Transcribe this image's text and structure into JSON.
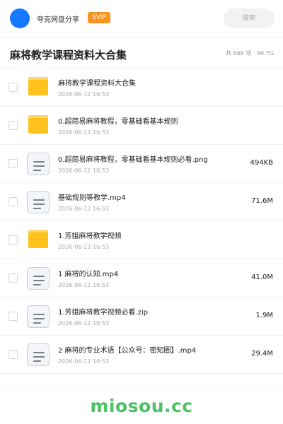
{
  "header": {
    "share_name": "夸克网盘分享",
    "badge": "SVIP",
    "search_placeholder": "搜索",
    "accent_color": "#1677ff",
    "badge_color": "#f7931e"
  },
  "folder": {
    "title": "麻将教学课程资料大合集",
    "summary": "共 666 项 · 96.7G"
  },
  "files": [
    {
      "type": "folder",
      "name": "麻将教学课程资料大合集",
      "date": "2026-06-12 16:53",
      "size": ""
    },
    {
      "type": "folder",
      "name": "0.超简易麻将教程，零基础看基本规则",
      "date": "2026-06-12 16:53",
      "size": ""
    },
    {
      "type": "file",
      "name": "0.超简易麻将教程，零基础看基本规则必看.png",
      "date": "2026-06-12 16:53",
      "size": "494KB"
    },
    {
      "type": "file",
      "name": "基础规则等教学.mp4",
      "date": "2026-06-12 16:53",
      "size": "71.6M"
    },
    {
      "type": "folder",
      "name": "1.芳姐麻将教学视频",
      "date": "2026-06-12 16:53",
      "size": ""
    },
    {
      "type": "file",
      "name": "1 麻将的认知.mp4",
      "date": "2026-06-12 16:53",
      "size": "41.0M"
    },
    {
      "type": "file",
      "name": "1.芳姐麻将教学视频必看.zip",
      "date": "2026-06-12 16:53",
      "size": "1.9M"
    },
    {
      "type": "file",
      "name": "2 麻将的专业术语【公众号：密知圈】.mp4",
      "date": "2026-06-12 16:53",
      "size": "29.4M"
    }
  ],
  "watermark": "miosou.cc",
  "icons": {
    "folder": "folder-icon",
    "file": "document-icon"
  }
}
